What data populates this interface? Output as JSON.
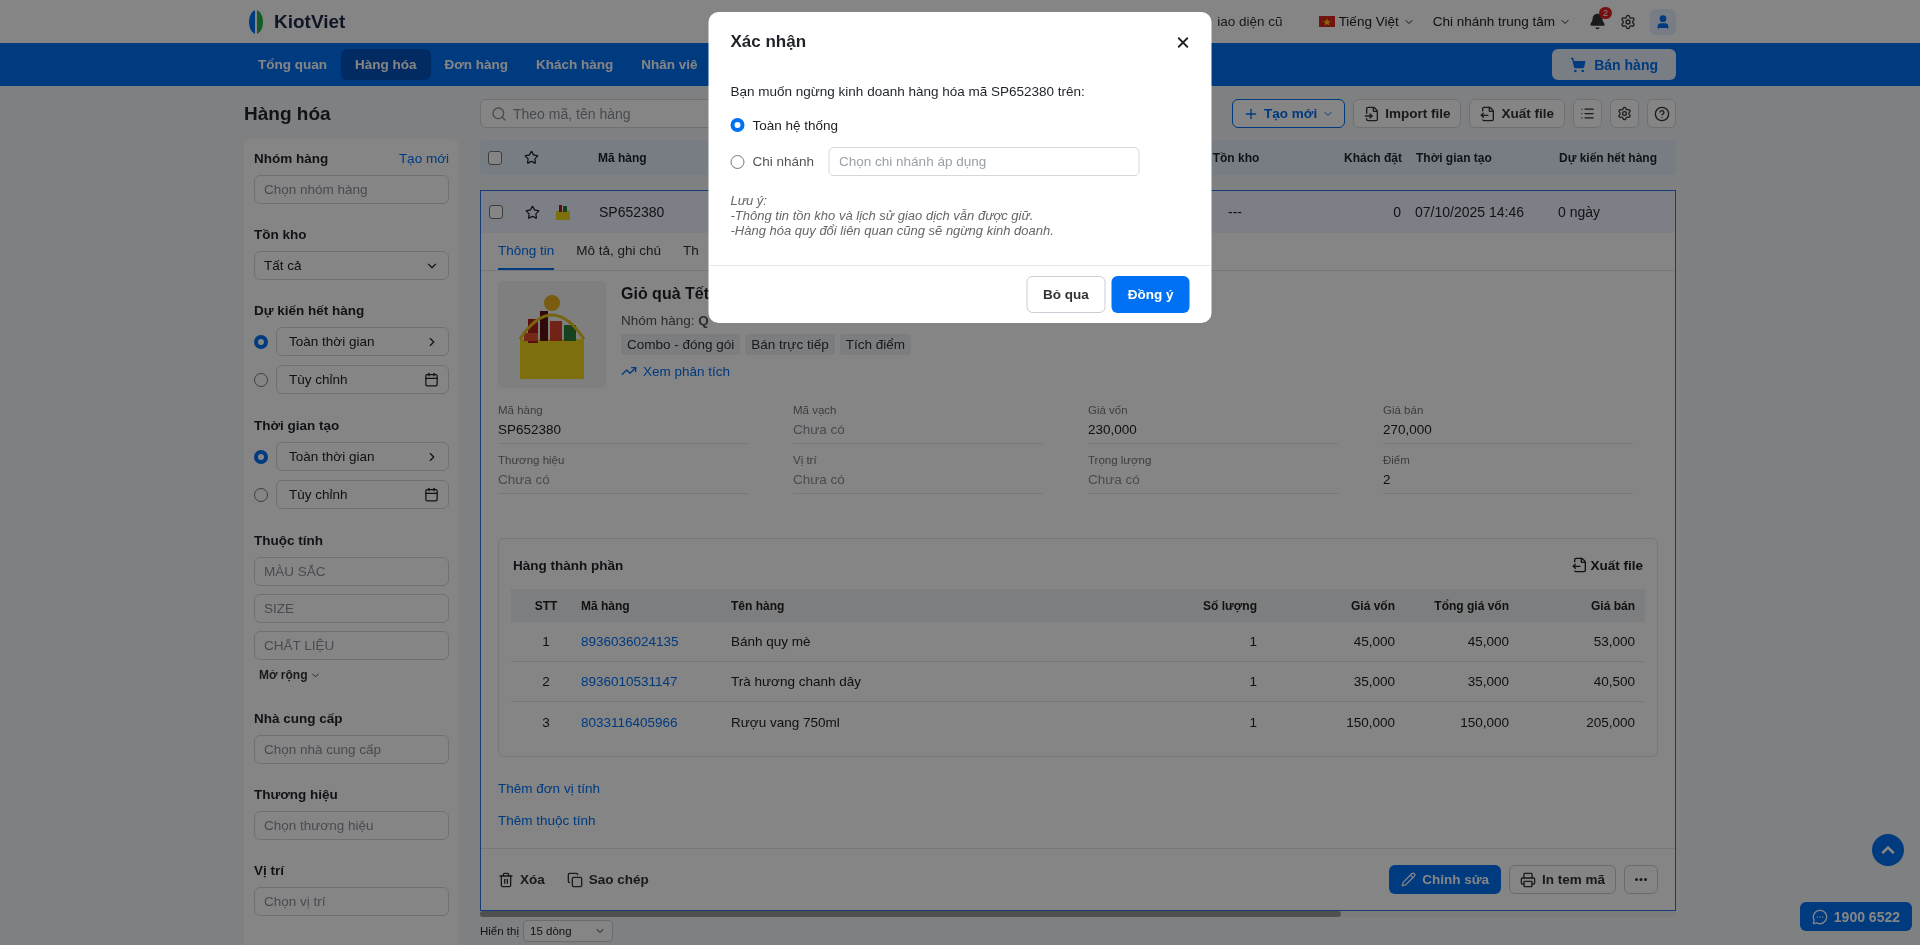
{
  "header": {
    "logo": "KiotViet",
    "old_ui_link": "iao diện cũ",
    "language": "Tiếng Việt",
    "branch": "Chi nhánh trung tâm",
    "notification_count": "2",
    "sell_button": "Bán hàng"
  },
  "nav": [
    {
      "label": "Tổng quan",
      "selected": false
    },
    {
      "label": "Hàng hóa",
      "selected": true
    },
    {
      "label": "Đơn hàng",
      "selected": false
    },
    {
      "label": "Khách hàng",
      "selected": false
    },
    {
      "label": "Nhân viê",
      "selected": false
    }
  ],
  "sidebar": {
    "title": "Hàng hóa",
    "sections": [
      {
        "kind": "combo",
        "label": "Nhóm hàng",
        "action": "Tạo mới",
        "placeholder": "Chọn nhóm hàng"
      },
      {
        "kind": "dropdown",
        "label": "Tồn kho",
        "value": "Tất cả"
      },
      {
        "kind": "radios",
        "label": "Dự kiến hết hàng",
        "options": [
          {
            "kind": "preset",
            "label": "Toàn thời gian",
            "selected": true
          },
          {
            "kind": "custom",
            "label": "Tùy chỉnh",
            "selected": false
          }
        ]
      },
      {
        "kind": "radios",
        "label": "Thời gian tạo",
        "options": [
          {
            "kind": "preset",
            "label": "Toàn thời gian",
            "selected": true
          },
          {
            "kind": "custom",
            "label": "Tùy chỉnh",
            "selected": false
          }
        ]
      },
      {
        "kind": "attributes",
        "label": "Thuộc tính",
        "fields": [
          "MÀU SẮC",
          "SIZE",
          "CHẤT LIỆU"
        ],
        "more": "Mở rộng"
      },
      {
        "kind": "combo",
        "label": "Nhà cung cấp",
        "placeholder": "Chọn nhà cung cấp"
      },
      {
        "kind": "combo",
        "label": "Thương hiệu",
        "placeholder": "Chọn thương hiệu"
      },
      {
        "kind": "combo",
        "label": "Vị trí",
        "placeholder": "Chọn vị trí"
      }
    ]
  },
  "toolbar": {
    "search_placeholder": "Theo mã, tên hàng",
    "create": "Tạo mới",
    "import": "Import file",
    "export": "Xuất file"
  },
  "table": {
    "select_all_checked": false,
    "columns": [
      "Mã hàng",
      "Tồn kho",
      "Khách đặt",
      "Thời gian tạo",
      "Dự kiến hết hàng"
    ],
    "row": {
      "checked": false,
      "code": "SP652380",
      "stock": "---",
      "ordered": "0",
      "created": "07/10/2025 14:46",
      "expected": "0 ngày"
    }
  },
  "detail": {
    "tabs": [
      {
        "label": "Thông tin",
        "selected": true
      },
      {
        "label": "Mô tả, ghi chú",
        "selected": false
      },
      {
        "label": "Th",
        "selected": false
      }
    ],
    "name": "Giỏ quà Tết",
    "group": "Nhóm hàng: **Q**",
    "tags": [
      "Combo - đóng gói",
      "Bán trực tiếp",
      "Tích điểm"
    ],
    "analysis_link": "Xem phân tích",
    "fields": [
      {
        "label": "Mã hàng",
        "value": "SP652380",
        "empty": false
      },
      {
        "label": "Mã vạch",
        "value": "Chưa có",
        "empty": true
      },
      {
        "label": "Giá vốn",
        "value": "230,000",
        "empty": false
      },
      {
        "label": "Giá bán",
        "value": "270,000",
        "empty": false
      },
      {
        "label": "Thương hiệu",
        "value": "Chưa có",
        "empty": true
      },
      {
        "label": "Vị trí",
        "value": "Chưa có",
        "empty": true
      },
      {
        "label": "Trọng lượng",
        "value": "Chưa có",
        "empty": true
      },
      {
        "label": "Điểm",
        "value": "2",
        "empty": false
      }
    ],
    "components": {
      "title": "Hàng thành phần",
      "export": "Xuất file",
      "columns": [
        "STT",
        "Mã hàng",
        "Tên hàng",
        "Số lượng",
        "Giá vốn",
        "Tổng giá vốn",
        "Giá bán"
      ],
      "rows": [
        [
          "1",
          "8936036024135",
          "Bánh quy mè",
          "1",
          "45,000",
          "45,000",
          "53,000"
        ],
        [
          "2",
          "8936010531147",
          "Trà hương chanh dây",
          "1",
          "35,000",
          "35,000",
          "40,500"
        ],
        [
          "3",
          "8033116405966",
          "Rượu vang 750ml",
          "1",
          "150,000",
          "150,000",
          "205,000"
        ]
      ]
    },
    "links": [
      "Thêm đơn vị tính",
      "Thêm thuộc tính"
    ],
    "actions": {
      "delete": "Xóa",
      "copy": "Sao chép",
      "edit": "Chỉnh sửa",
      "print": "In tem mã"
    }
  },
  "pagination": {
    "label": "Hiển thị",
    "value": "15 dòng"
  },
  "hotline": "1900 6522",
  "modal": {
    "title": "Xác nhận",
    "message": "Bạn muốn ngừng kinh doanh hàng hóa mã SP652380 trên:",
    "options": [
      {
        "kind": "all",
        "label": "Toàn hệ thống",
        "selected": true
      },
      {
        "kind": "branch",
        "label": "Chi nhánh",
        "selected": false,
        "placeholder": "Chọn chi nhánh áp dụng"
      }
    ],
    "note": [
      "Lưu ý:",
      "-Thông tin tồn kho và lịch sử giao dịch vẫn được giữ.",
      "-Hàng hóa quy đổi liên quan cũng sẽ ngừng kinh doanh."
    ],
    "cancel": "Bỏ qua",
    "confirm": "Đồng ý"
  }
}
